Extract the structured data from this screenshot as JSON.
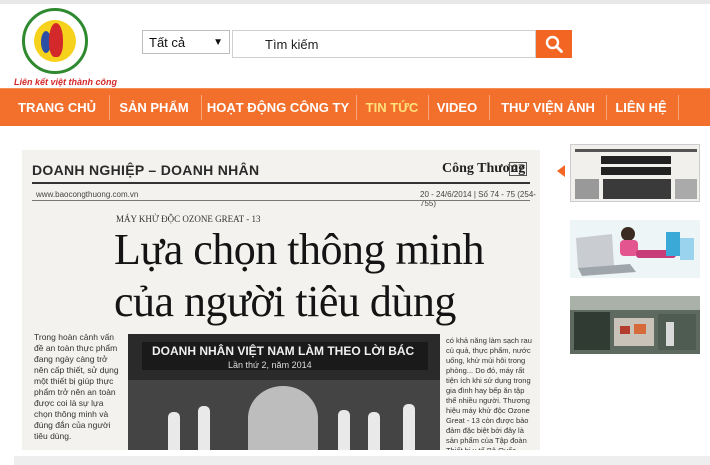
{
  "header": {
    "logo_caption": "Liên kết việt thành công"
  },
  "search": {
    "category_selected": "Tất cả",
    "placeholder": "Tìm kiếm"
  },
  "nav": {
    "items": [
      {
        "label": "TRANG CHỦ"
      },
      {
        "label": "SẢN PHẨM"
      },
      {
        "label": "HOẠT ĐỘNG CÔNG TY"
      },
      {
        "label": "TIN TỨC",
        "active": true
      },
      {
        "label": "VIDEO"
      },
      {
        "label": "THƯ VIỆN ẢNH"
      },
      {
        "label": "LIÊN HỆ"
      }
    ]
  },
  "article": {
    "section_header": "DOANH NGHIỆP – DOANH NHÂN",
    "paper_name": "Công Thương",
    "page_number": "27",
    "website": "www.baocongthuong.com.vn",
    "issue_date": "20 - 24/6/2014 | Số 74 - 75 (254-755)",
    "kicker": "MÁY KHỬ ĐỘC OZONE GREAT - 13",
    "headline_line1": "Lựa chọn thông minh",
    "headline_line2": "của người tiêu dùng",
    "lead_text": "Trong hoàn cảnh vấn đề an toàn thực phẩm đang ngày càng trở nên cấp thiết, sử dụng một thiết bị giúp thực phẩm trở nên an toàn được coi là sự lựa chọn thông minh và đúng đắn của người tiêu dùng.",
    "photo_banner": "DOANH NHÂN VIỆT NAM LÀM THEO LỜI BÁC",
    "photo_sub": "Lần thứ 2, năm 2014",
    "side_text": "có khả năng làm sạch rau củ quả, thực phẩm, nước uống, khử mùi hôi trong phòng... Do đó, máy rất tiện ích khi sử dụng trong gia đình hay bếp ăn tập thể nhiều người. Thương hiệu máy khử độc Ozone Great - 13 còn được bảo đảm đặc biệt bởi đây là sản phẩm của Tập đoàn Thiết bị y tế Bộ Quốc phòng hợp tác sản xuất cùng Công ty Thanh Hà - Bộ Quốc phòng và"
  },
  "colors": {
    "brand_orange": "#f26f2c",
    "active_nav": "#ffe27a",
    "search_button": "#f26522"
  },
  "icons": {
    "search": "magnifier-icon",
    "select": "caret-down-icon"
  }
}
